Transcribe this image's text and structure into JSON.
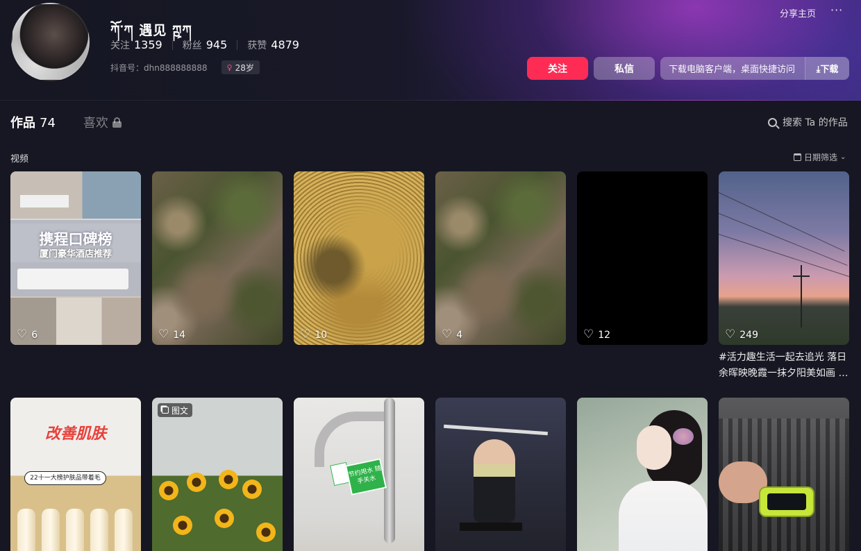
{
  "profile": {
    "nickname": "ཀོ་ཀ 遇见 ཀྵཀ",
    "stats": [
      {
        "label": "关注",
        "value": "1359"
      },
      {
        "label": "粉丝",
        "value": "945"
      },
      {
        "label": "获赞",
        "value": "4879"
      }
    ],
    "douyin_id": "抖音号：dhn888888888",
    "age_badge": "28岁"
  },
  "header": {
    "share_home": "分享主页",
    "more_icon": "···",
    "follow_label": "关注",
    "message_label": "私信",
    "download_text": "下载电脑客户端，桌面快捷访问",
    "download_label": "⤓下载"
  },
  "tabs": {
    "works_label": "作品",
    "works_count": "74",
    "likes_label": "喜欢",
    "search_label": "搜索 Ta 的作品"
  },
  "section": {
    "label": "视频",
    "date_filter": "日期筛选"
  },
  "videos": [
    {
      "likes": "6",
      "overlay_title": "携程口碑榜",
      "overlay_subtitle": "厦门豪华酒店推荐"
    },
    {
      "likes": "14"
    },
    {
      "likes": "10"
    },
    {
      "likes": "4"
    },
    {
      "likes": "12"
    },
    {
      "likes": "249",
      "caption": "#活力趣生活一起去追光 落日余晖映晚霞一抹夕阳美如画 …"
    },
    {
      "overlay_title": "改善肌肤",
      "overlay_bubble": "22十一大榜护肤品带着毛"
    },
    {
      "badge": "图文"
    },
    {
      "overlay_sign": "节约用水 随手关水"
    },
    {},
    {},
    {}
  ],
  "colors": {
    "accent": "#fe2c55",
    "background": "#161722"
  }
}
